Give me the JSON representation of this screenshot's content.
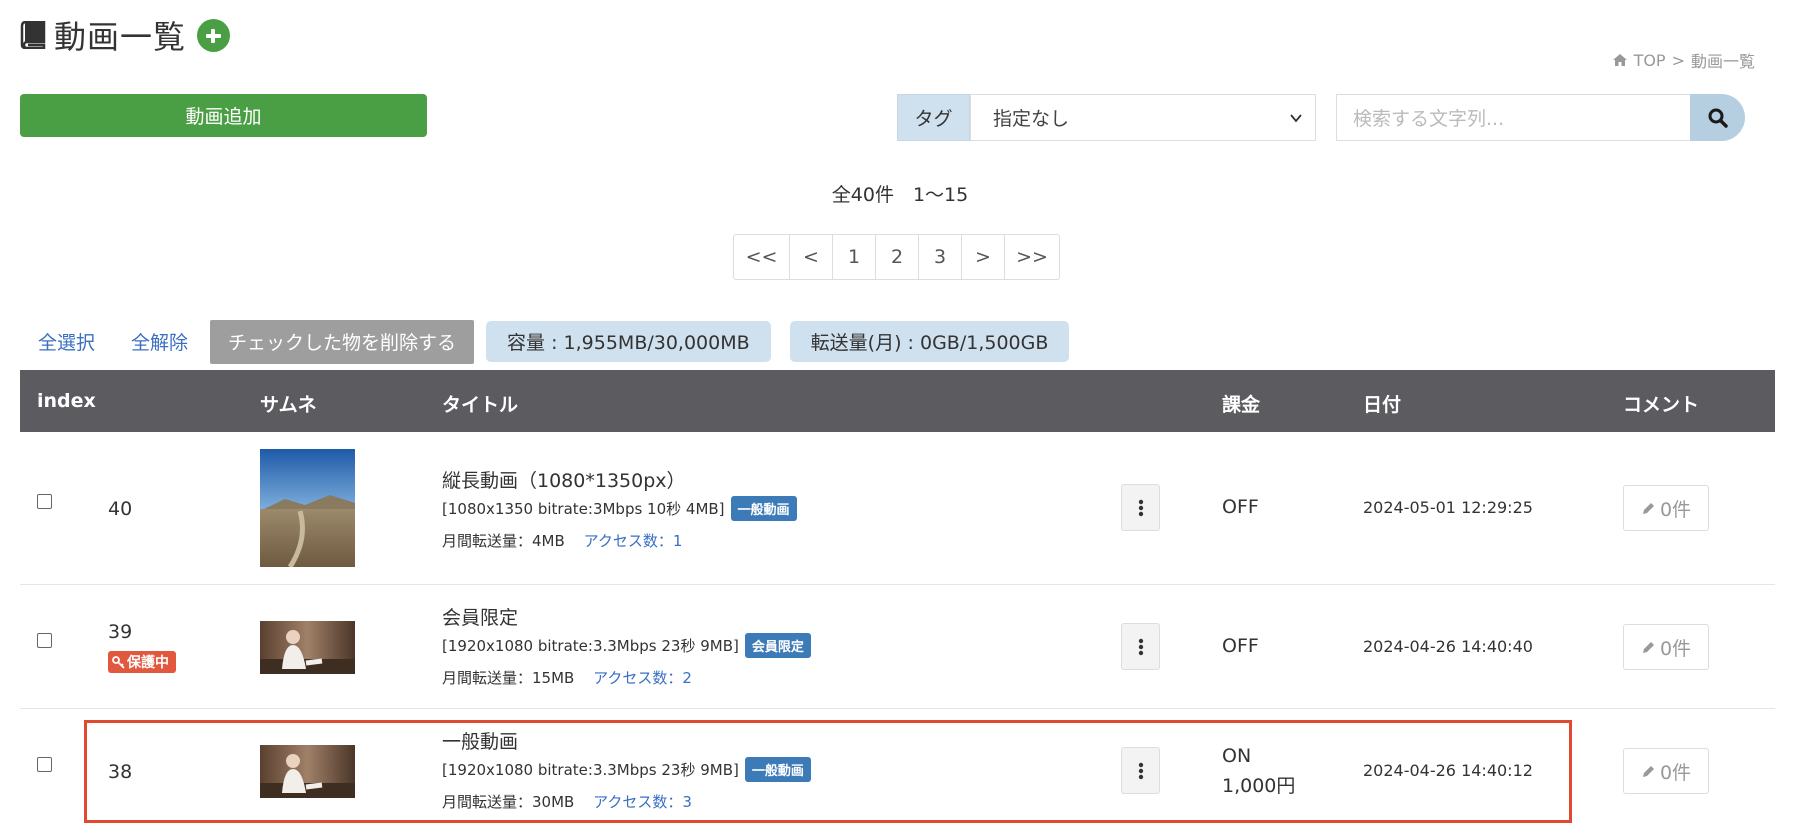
{
  "header": {
    "title": "動画一覧",
    "breadcrumb": {
      "home": "TOP",
      "sep": ">",
      "current": "動画一覧"
    }
  },
  "toolbar": {
    "add_label": "動画追加",
    "tag_label": "タグ",
    "tag_value": "指定なし",
    "search_placeholder": "検索する文字列..."
  },
  "summary": {
    "count_text": "全40件　1〜15"
  },
  "pagination": [
    "<<",
    "<",
    "1",
    "2",
    "3",
    ">",
    ">>"
  ],
  "actions": {
    "select_all": "全選択",
    "deselect_all": "全解除",
    "delete_checked": "チェックした物を削除する",
    "capacity": "容量 : 1,955MB/30,000MB",
    "transfer": "転送量(月) : 0GB/1,500GB"
  },
  "table": {
    "headers": [
      "index",
      "サムネ",
      "タイトル",
      "課金",
      "日付",
      "コメント"
    ],
    "rows": [
      {
        "index": "40",
        "protected": "",
        "title": "縦長動画（1080*1350px）",
        "meta": "[1080x1350 bitrate:3Mbps 10秒 4MB]",
        "badge": "一般動画",
        "transfer": "月間転送量：4MB",
        "access": "アクセス数：1",
        "billing": "OFF",
        "billing_price": "",
        "date": "2024-05-01 12:29:25",
        "comments": "0件"
      },
      {
        "index": "39",
        "protected": "保護中",
        "title": "会員限定",
        "meta": "[1920x1080 bitrate:3.3Mbps 23秒 9MB]",
        "badge": "会員限定",
        "transfer": "月間転送量：15MB",
        "access": "アクセス数：2",
        "billing": "OFF",
        "billing_price": "",
        "date": "2024-04-26 14:40:40",
        "comments": "0件"
      },
      {
        "index": "38",
        "protected": "",
        "title": "一般動画",
        "meta": "[1920x1080 bitrate:3.3Mbps 23秒 9MB]",
        "badge": "一般動画",
        "transfer": "月間転送量：30MB",
        "access": "アクセス数：3",
        "billing": "ON",
        "billing_price": "1,000円",
        "date": "2024-04-26 14:40:12",
        "comments": "0件"
      }
    ]
  },
  "colors": {
    "green": "#4a9e44",
    "header_bg": "#5b5b60",
    "badge_blue": "#3d7ab8",
    "protect_red": "#e2583e",
    "highlight_red": "#e04a33",
    "link_blue": "#3a6fc4"
  }
}
